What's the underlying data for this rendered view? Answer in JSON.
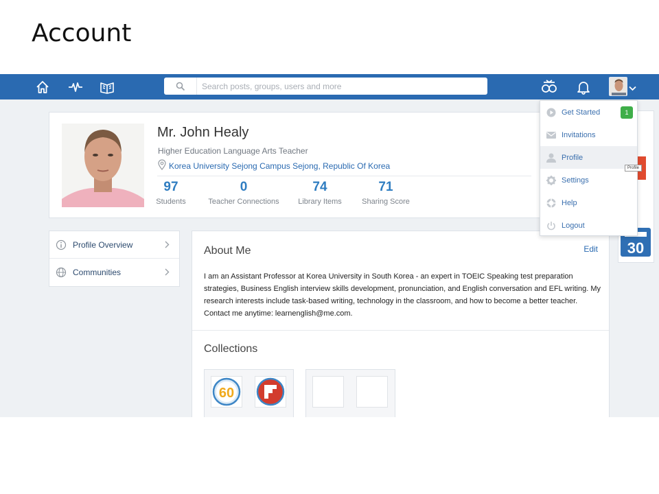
{
  "slide": {
    "title": "Account"
  },
  "search": {
    "placeholder": "Search posts, groups, users and more"
  },
  "nav": {
    "icons": [
      "home-icon",
      "activity-icon",
      "library-icon",
      "apps-icon",
      "bell-icon"
    ]
  },
  "profile": {
    "name": "Mr. John Healy",
    "role": "Higher Education Language Arts Teacher",
    "location": "Korea University Sejong Campus Sejong, Republic Of Korea",
    "stats": [
      {
        "value": "97",
        "label": "Students"
      },
      {
        "value": "0",
        "label": "Teacher Connections"
      },
      {
        "value": "74",
        "label": "Library Items"
      },
      {
        "value": "71",
        "label": "Sharing Score"
      }
    ]
  },
  "side_menu": {
    "items": [
      {
        "label": "Profile Overview"
      },
      {
        "label": "Communities"
      }
    ]
  },
  "about": {
    "title": "About Me",
    "edit_label": "Edit",
    "text": "I am an Assistant Professor at Korea University in South Korea - an expert in TOEIC Speaking test preparation strategies, Business English interview skills development, pronunciation, and English conversation and EFL writing. My research interests include task-based writing, technology in the classroom, and how to become a better teacher. Contact me anytime: learnenglish@me.com."
  },
  "collections": {
    "title": "Collections",
    "badge_number": "60"
  },
  "right_column": {
    "badge_number": "30"
  },
  "dropdown": {
    "items": [
      {
        "label": "Get Started",
        "badge": "1"
      },
      {
        "label": "Invitations"
      },
      {
        "label": "Profile"
      },
      {
        "label": "Settings"
      },
      {
        "label": "Help"
      },
      {
        "label": "Logout"
      }
    ],
    "tooltip": "Profile"
  },
  "colors": {
    "topbar": "#2a6ab1",
    "link": "#2a6ab1",
    "stat": "#2f7dc1",
    "badge": "#3fae49",
    "accent_red": "#e04b2f",
    "calendar_blue": "#2f6fb4"
  }
}
